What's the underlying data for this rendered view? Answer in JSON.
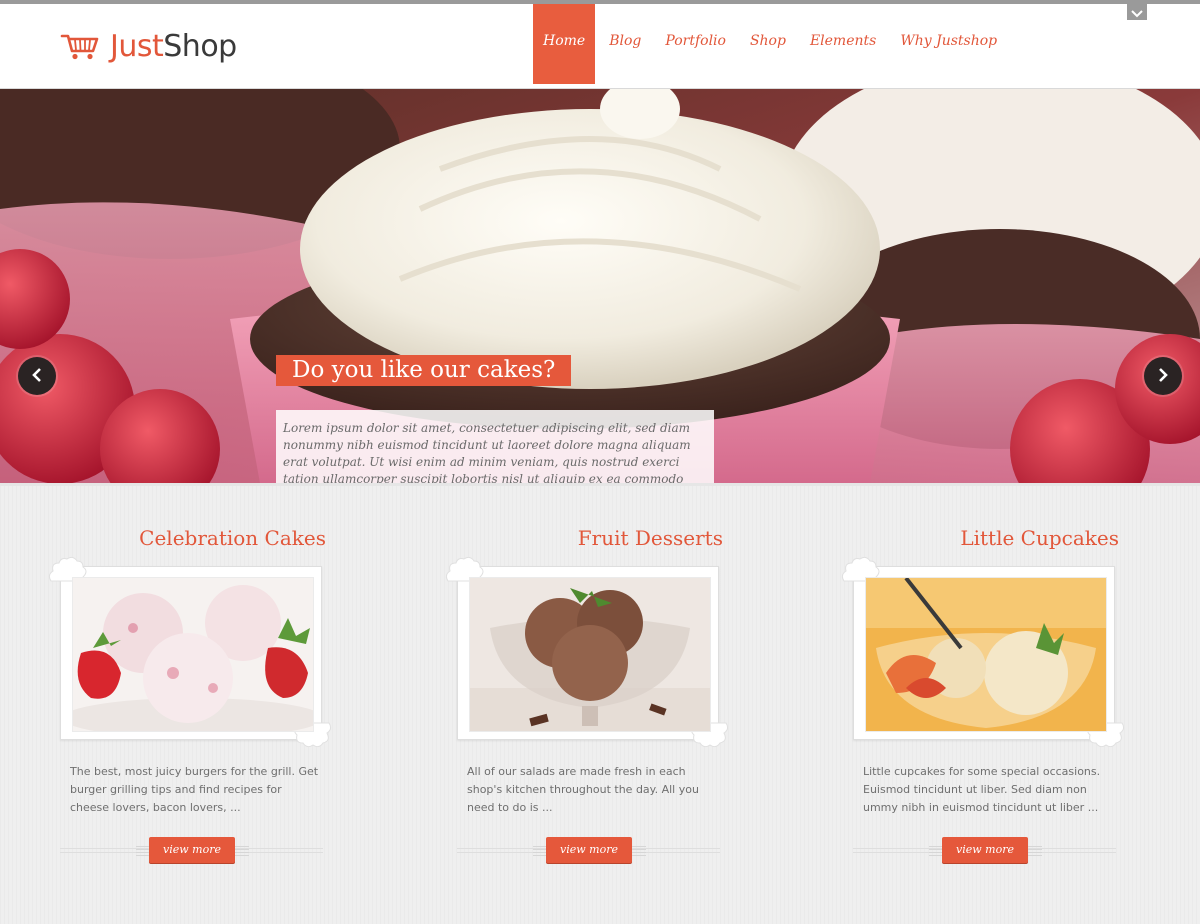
{
  "header": {
    "logo": {
      "just": "Just",
      "shop": "Shop"
    },
    "nav": [
      "Home",
      "Blog",
      "Portfolio",
      "Shop",
      "Elements",
      "Why Justshop"
    ],
    "active_nav": "Home"
  },
  "slider": {
    "title": "Do you like our cakes?",
    "text": "Lorem ipsum dolor sit amet, consectetuer adipiscing elit, sed diam nonummy nibh euismod tincidunt ut laoreet dolore magna aliquam erat volutpat. Ut wisi enim ad minim veniam, quis nostrud exerci tation ullamcorper suscipit lobortis nisl ut aliquip ex ea commodo cequat.",
    "prev_icon": "chevron-left-icon",
    "next_icon": "chevron-right-icon"
  },
  "features": [
    {
      "title": "Celebration Cakes",
      "text": "The best, most juicy burgers for the grill. Get burger grilling tips and find recipes for cheese lovers, bacon lovers, ...",
      "button": "view more"
    },
    {
      "title": "Fruit Desserts",
      "text": "All of our salads are made fresh in each shop's kitchen throughout the day. All you need to do is ...",
      "button": "view more"
    },
    {
      "title": "Little Cupcakes",
      "text": "Little cupcakes for some special occasions. Euismod tincidunt ut liber. Sed diam non ummy nibh in euismod tincidunt ut liber ...",
      "button": "view more"
    }
  ],
  "colors": {
    "accent": "#e5583b",
    "topbar": "#9a9a9a",
    "text": "#6f6f6f"
  }
}
